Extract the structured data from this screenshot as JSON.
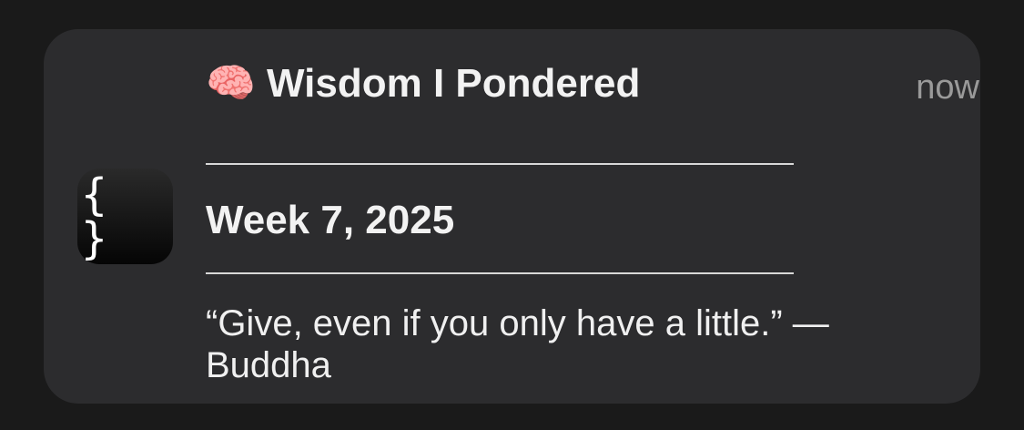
{
  "notification": {
    "title": "🧠 Wisdom I Pondered",
    "timestamp": "now",
    "app_icon_glyph": "{ }",
    "app_icon_name": "curly-braces-icon",
    "week_label": "Week 7, 2025",
    "quote": "“Give, even if you only have a little.” — Buddha"
  },
  "colors": {
    "background": "#1a1a1a",
    "card": "#2c2c2e",
    "title_text": "#f2f2f2",
    "timestamp_text": "#9a9a9a",
    "rule": "#d8d8d8"
  }
}
